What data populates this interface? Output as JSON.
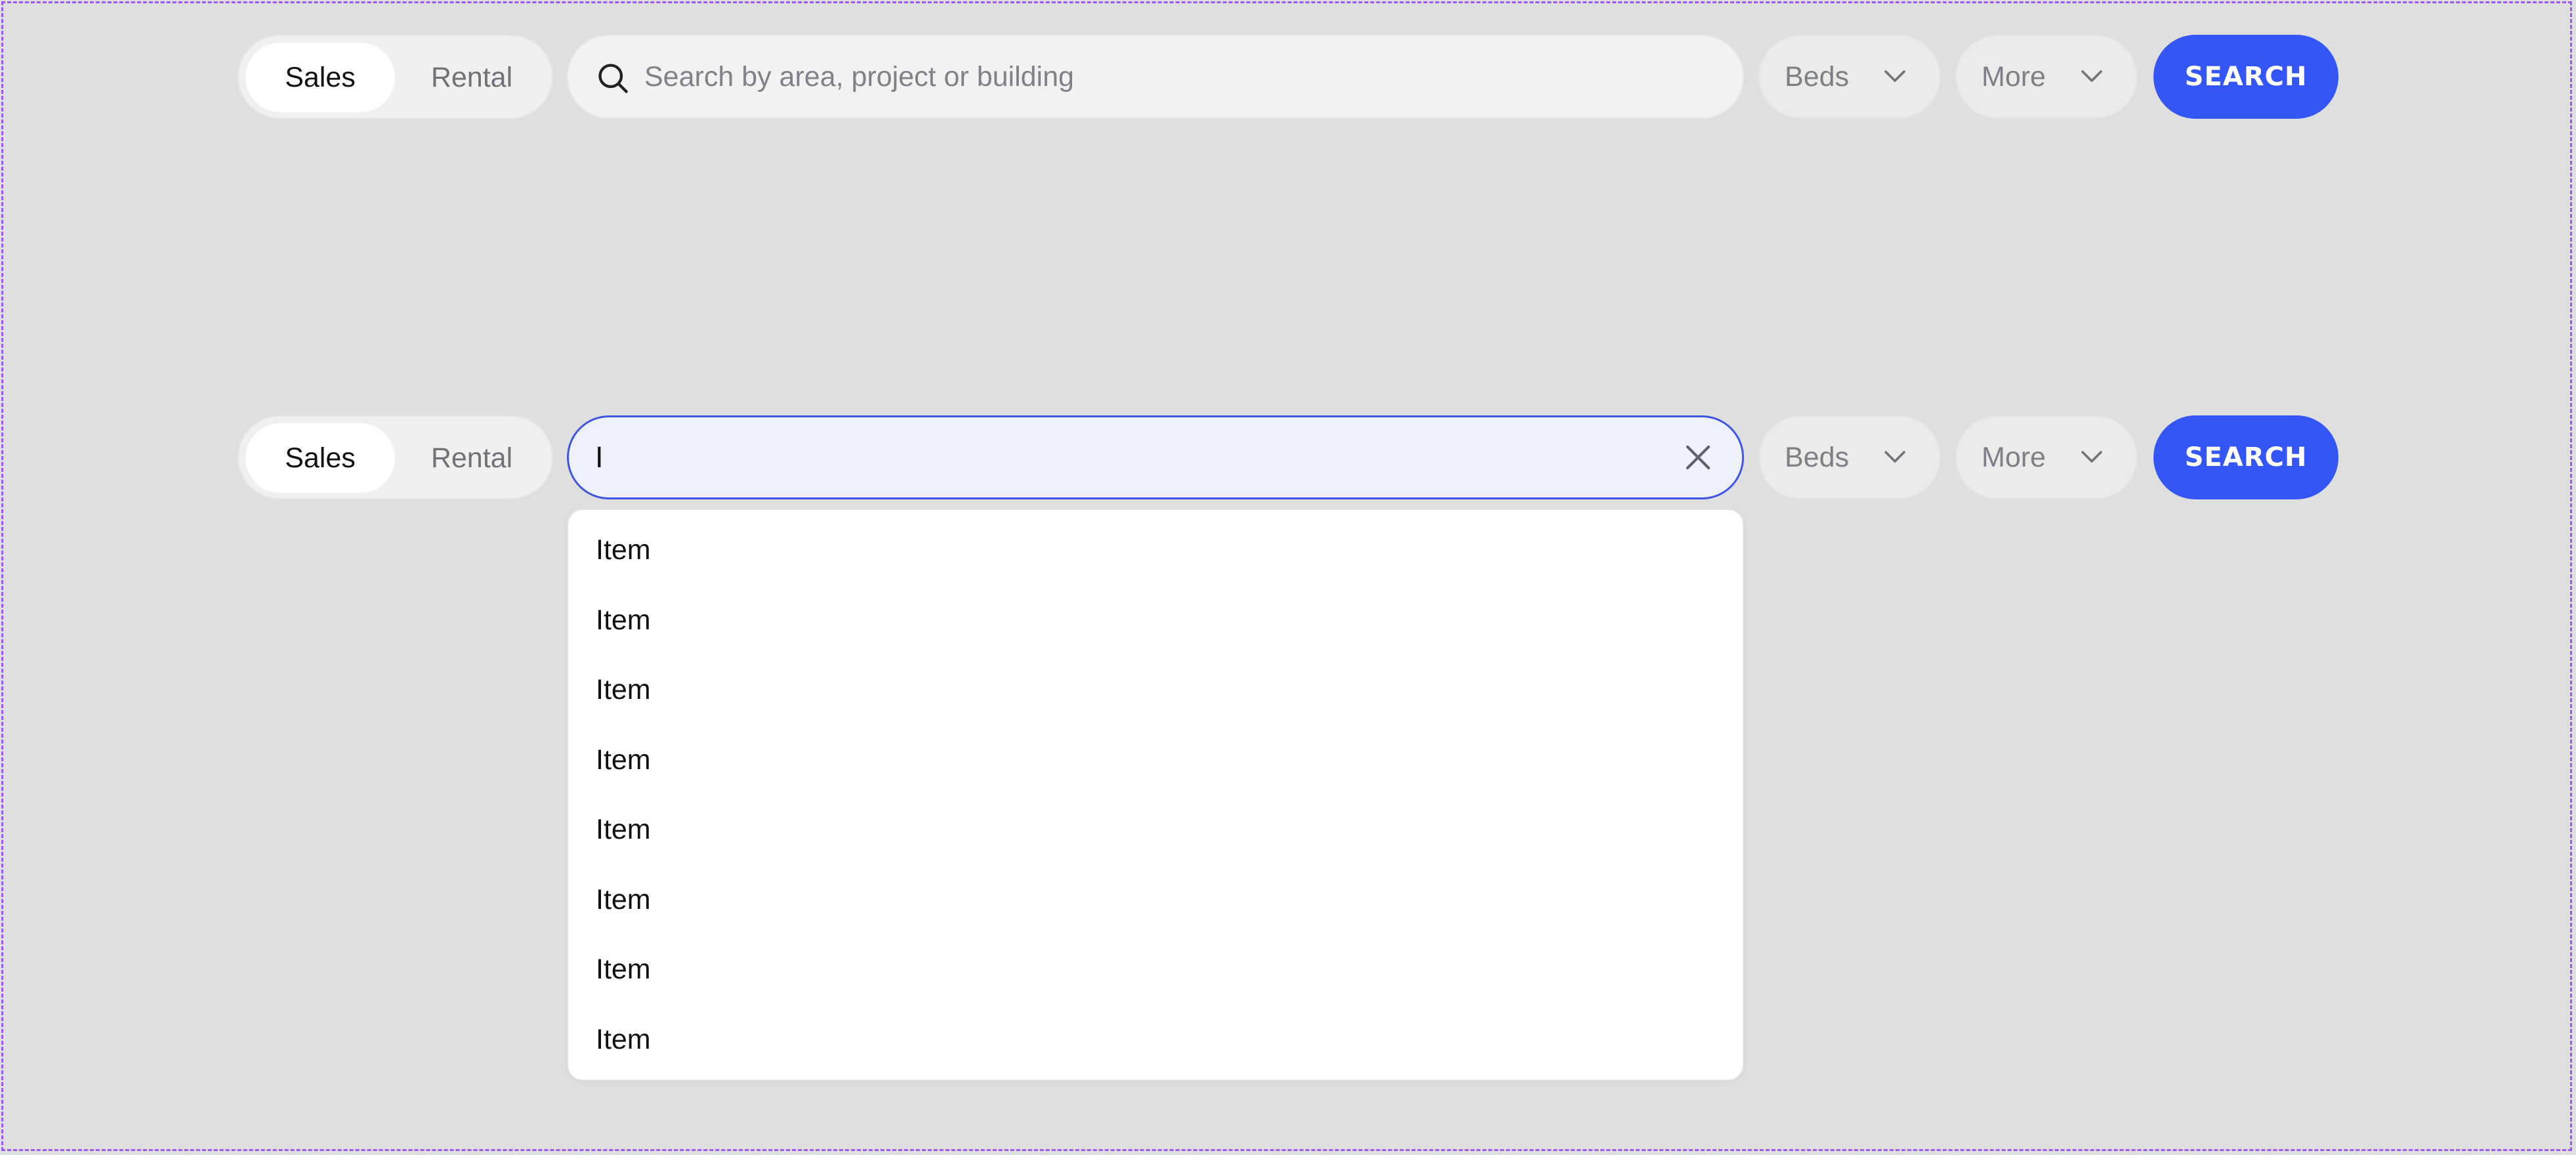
{
  "search_bar_default": {
    "mode_toggle": {
      "sales_label": "Sales",
      "rental_label": "Rental",
      "selected": "Sales"
    },
    "search": {
      "placeholder": "Search by area, project or building",
      "value": ""
    },
    "beds_label": "Beds",
    "more_label": "More",
    "search_button_label": "SEARCH"
  },
  "search_bar_active": {
    "mode_toggle": {
      "sales_label": "Sales",
      "rental_label": "Rental",
      "selected": "Sales"
    },
    "search": {
      "value": "I"
    },
    "beds_label": "Beds",
    "more_label": "More",
    "search_button_label": "SEARCH",
    "suggestions": [
      "Item",
      "Item",
      "Item",
      "Item",
      "Item",
      "Item",
      "Item",
      "Item"
    ]
  },
  "icons": {
    "search": "search-icon",
    "clear": "close-icon",
    "dropdown": "chevron-down-icon"
  },
  "colors": {
    "background": "#e0dfe0",
    "accent": "#3456f7",
    "focus_border": "#3d55e0",
    "focus_fill": "#eef1fc",
    "frame_border": "#9b59f5"
  }
}
